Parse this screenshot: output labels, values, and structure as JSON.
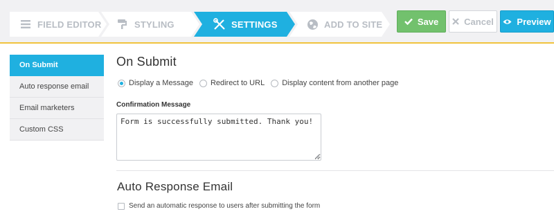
{
  "steps": [
    {
      "label": "FIELD EDITOR",
      "icon": "list-icon",
      "state": "done"
    },
    {
      "label": "STYLING",
      "icon": "paint-roller-icon",
      "state": "done"
    },
    {
      "label": "SETTINGS",
      "icon": "tools-icon",
      "state": "active"
    },
    {
      "label": "ADD TO SITE",
      "icon": "globe-icon",
      "state": "todo"
    }
  ],
  "actions": {
    "save_label": "Save",
    "cancel_label": "Cancel",
    "preview_label": "Preview"
  },
  "sidebar": {
    "items": [
      {
        "label": "On Submit",
        "active": true
      },
      {
        "label": "Auto response email",
        "active": false
      },
      {
        "label": "Email marketers",
        "active": false
      },
      {
        "label": "Custom CSS",
        "active": false
      }
    ]
  },
  "on_submit": {
    "title": "On Submit",
    "options": [
      {
        "label": "Display a Message",
        "checked": true
      },
      {
        "label": "Redirect to URL",
        "checked": false
      },
      {
        "label": "Display content from another page",
        "checked": false
      }
    ],
    "confirmation_label": "Confirmation Message",
    "confirmation_value": "Form is successfully submitted. Thank you!"
  },
  "auto_response": {
    "title": "Auto Response Email",
    "checkbox_label": "Send an automatic response to users after submitting the form",
    "checked": false
  },
  "colors": {
    "accent": "#1fb0e0",
    "save": "#72c16d",
    "topbar_rule": "#f0c33c",
    "step_bg": "#ffffff",
    "muted": "#b8bdc4"
  }
}
